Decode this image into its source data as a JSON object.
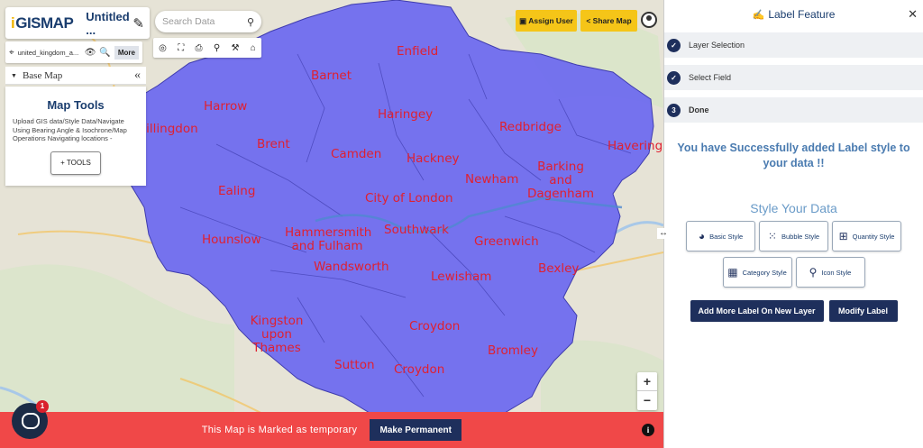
{
  "app": {
    "logo_text": "GISMAP",
    "map_title": "Untitled ...",
    "layer_name": "united_kingdom_a...",
    "more_label": "More",
    "base_map_label": "Base Map"
  },
  "map_tools": {
    "title": "Map Tools",
    "description": "Upload GIS data/Style Data/Navigate Using Bearing Angle & Isochrone/Map Operations Navigating locations -",
    "tools_button": "+ TOOLS"
  },
  "search": {
    "placeholder": "Search Data"
  },
  "header_buttons": {
    "assign_user": "Assign User",
    "share_map": "Share Map"
  },
  "districts": [
    "Enfield",
    "Barnet",
    "Harrow",
    "Haringey",
    "Redbridge",
    "Hillingdon",
    "Brent",
    "Camden",
    "Hackney",
    "Havering",
    "Barking and Dagenham",
    "Newham",
    "Ealing",
    "City of London",
    "Hounslow",
    "Hammersmith and Fulham",
    "Southwark",
    "Greenwich",
    "Wandsworth",
    "Bexley",
    "Lewisham",
    "Kingston upon Thames",
    "Croydon",
    "Bromley",
    "Sutton",
    "Croydon"
  ],
  "temp_bar": {
    "text": "This Map is Marked as temporary",
    "button": "Make Permanent"
  },
  "chat_badge": "1",
  "panel": {
    "title": "Label Feature",
    "steps": [
      {
        "num": "",
        "label": "Layer Selection"
      },
      {
        "num": "",
        "label": "Select Field"
      },
      {
        "num": "3",
        "label": "Done"
      }
    ],
    "success": "You have Successfully added Label style to your data !!",
    "style_title": "Style Your Data",
    "styles": [
      {
        "label": "Basic Style",
        "icon": "basic-style-icon"
      },
      {
        "label": "Bubble Style",
        "icon": "bubble-style-icon"
      },
      {
        "label": "Quantity Style",
        "icon": "quantity-style-icon"
      },
      {
        "label": "Category Style",
        "icon": "category-style-icon"
      },
      {
        "label": "Icon Style",
        "icon": "pin-icon"
      }
    ],
    "actions": {
      "add_more": "Add More Label On New Layer",
      "modify": "Modify Label"
    }
  },
  "colors": {
    "region_fill": "#6b68f0",
    "label_red": "#e02030",
    "navy": "#1e2f5c",
    "yellow": "#f5c518",
    "banner_red": "#f04848"
  }
}
